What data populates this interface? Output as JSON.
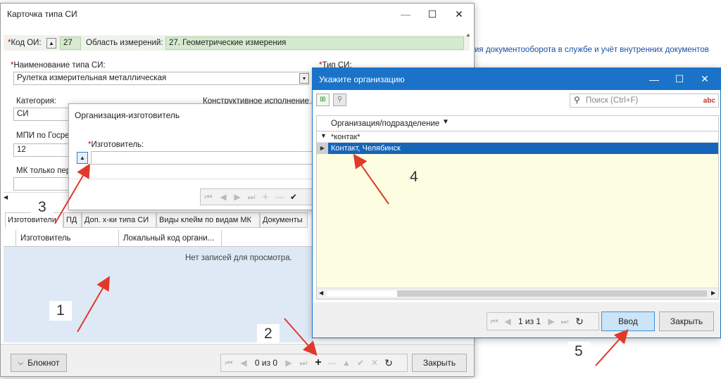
{
  "background_link": "ия документооборота в службе и учёт внутренних документов",
  "card": {
    "title": "Карточка типа СИ",
    "code_label": "Код ОИ:",
    "code_value": "27",
    "area_label": "Область измерений:",
    "area_value": "27. Геометрические измерения",
    "name_label": "Наименование типа СИ:",
    "name_value": "Рулетка измерительная металлическая",
    "type_label": "Тип СИ:",
    "category_label": "Категория:",
    "category_value": "СИ",
    "construct_label": "Конструктивное исполнение",
    "mpi_label": "МПИ по Госре",
    "mpi_value": "12",
    "mk_label": "МК только пер",
    "tabs": [
      "Изготовители",
      "ПД",
      "Доп. х-ки типа СИ",
      "Виды клейм по видам МК",
      "Документы"
    ],
    "columns": [
      "Изготовитель",
      "Локальный код органи..."
    ],
    "empty_text": "Нет записей для просмотра.",
    "notepad_label": "Блокнот",
    "pager_text": "0 из 0",
    "close_label": "Закрыть"
  },
  "manufacturer_dialog": {
    "title": "Организация-изготовитель",
    "field_label": "Изготовитель:"
  },
  "org_dialog": {
    "title": "Укажите организацию",
    "search_placeholder": "Поиск (Ctrl+F)",
    "search_suffix": "abc",
    "column_header": "Организация/подразделение",
    "filter_value": "*контак*",
    "row_value": "Контакт, Челябинск",
    "pager_text": "1 из 1",
    "enter_label": "Ввод",
    "close_label": "Закрыть"
  },
  "annotations": [
    "1",
    "2",
    "3",
    "4",
    "5"
  ],
  "colors": {
    "accent": "#1a73c9",
    "selected_row": "#1665b8",
    "green_field": "#d6ead0",
    "grid_bg": "#dfe9f6",
    "yellow_bg": "#fdfde2",
    "arrow": "#e0392a"
  }
}
